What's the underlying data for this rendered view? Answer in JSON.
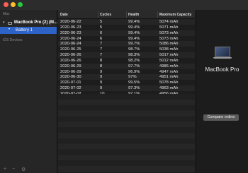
{
  "sidebar": {
    "mac_label": "Mac",
    "device_name": "MacBook Pro (2) (M...",
    "battery_label": "Battery 1",
    "ios_label": "iOS Devices",
    "bottom_icons": [
      "add-icon",
      "remove-icon",
      "settings-icon"
    ]
  },
  "table": {
    "columns": [
      "Date",
      "Cycles",
      "Health",
      "Maximum Capacity"
    ],
    "rows": [
      [
        "2020-06-22",
        "5",
        "99.4%",
        "5074 mAh"
      ],
      [
        "2020-06-23",
        "5",
        "99.4%",
        "5071 mAh"
      ],
      [
        "2020-06-23",
        "6",
        "99.4%",
        "5073 mAh"
      ],
      [
        "2020-06-24",
        "6",
        "99.4%",
        "5073 mAh"
      ],
      [
        "2020-06-24",
        "7",
        "99.7%",
        "5086 mAh"
      ],
      [
        "2020-06-25",
        "7",
        "98.7%",
        "5038 mAh"
      ],
      [
        "2020-06-26",
        "7",
        "98.3%",
        "5017 mAh"
      ],
      [
        "2020-06-26",
        "8",
        "98.2%",
        "5012 mAh"
      ],
      [
        "2020-06-29",
        "8",
        "97.7%",
        "4986 mAh"
      ],
      [
        "2020-06-29",
        "9",
        "96.9%",
        "4947 mAh"
      ],
      [
        "2020-06-30",
        "9",
        "97%",
        "4951 mAh"
      ],
      [
        "2020-07-01",
        "9",
        "99.5%",
        "5078 mAh"
      ],
      [
        "2020-07-02",
        "9",
        "97.3%",
        "4963 mAh"
      ],
      [
        "2020-07-02",
        "10",
        "97.1%",
        "4956 mAh"
      ]
    ]
  },
  "detail": {
    "model_name": "MacBook Pro",
    "compare_button": "Compare online"
  },
  "colors": {
    "selection": "#2d62c6",
    "close": "#fe5f57",
    "minimize": "#febc2e",
    "zoom": "#28c840"
  }
}
